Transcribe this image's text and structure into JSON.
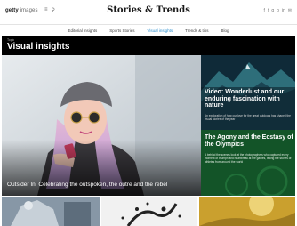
{
  "header": {
    "logo_main": "getty",
    "logo_sub": "images",
    "brand": "Stories & Trends",
    "top_icons": [
      "≡",
      "⚲"
    ],
    "social_icons": [
      "f",
      "t",
      "g",
      "p",
      "in",
      "✉"
    ]
  },
  "nav": {
    "items": [
      "Editorial insights",
      "Sports Stories",
      "Visual insights",
      "Trends & tips",
      "Blog"
    ],
    "active_index": 2
  },
  "section": {
    "eyebrow": "Topic",
    "title": "Visual insights"
  },
  "hero": {
    "caption": "Outsider In: Celebrating the outspoken, the outre and the rebel"
  },
  "tile1": {
    "title": "Video: Wonderlust and our enduring fascination with nature",
    "desc": "An exploration of how our love for the great outdoors has shaped the visual stories of the year"
  },
  "tile2": {
    "title": "The Agony and the Ecstasy of the Olympics",
    "desc": "A behind the scenes look at the photographers who captured every moment of triumph and heartbreak at the games, telling the stories of athletes from around the world"
  }
}
